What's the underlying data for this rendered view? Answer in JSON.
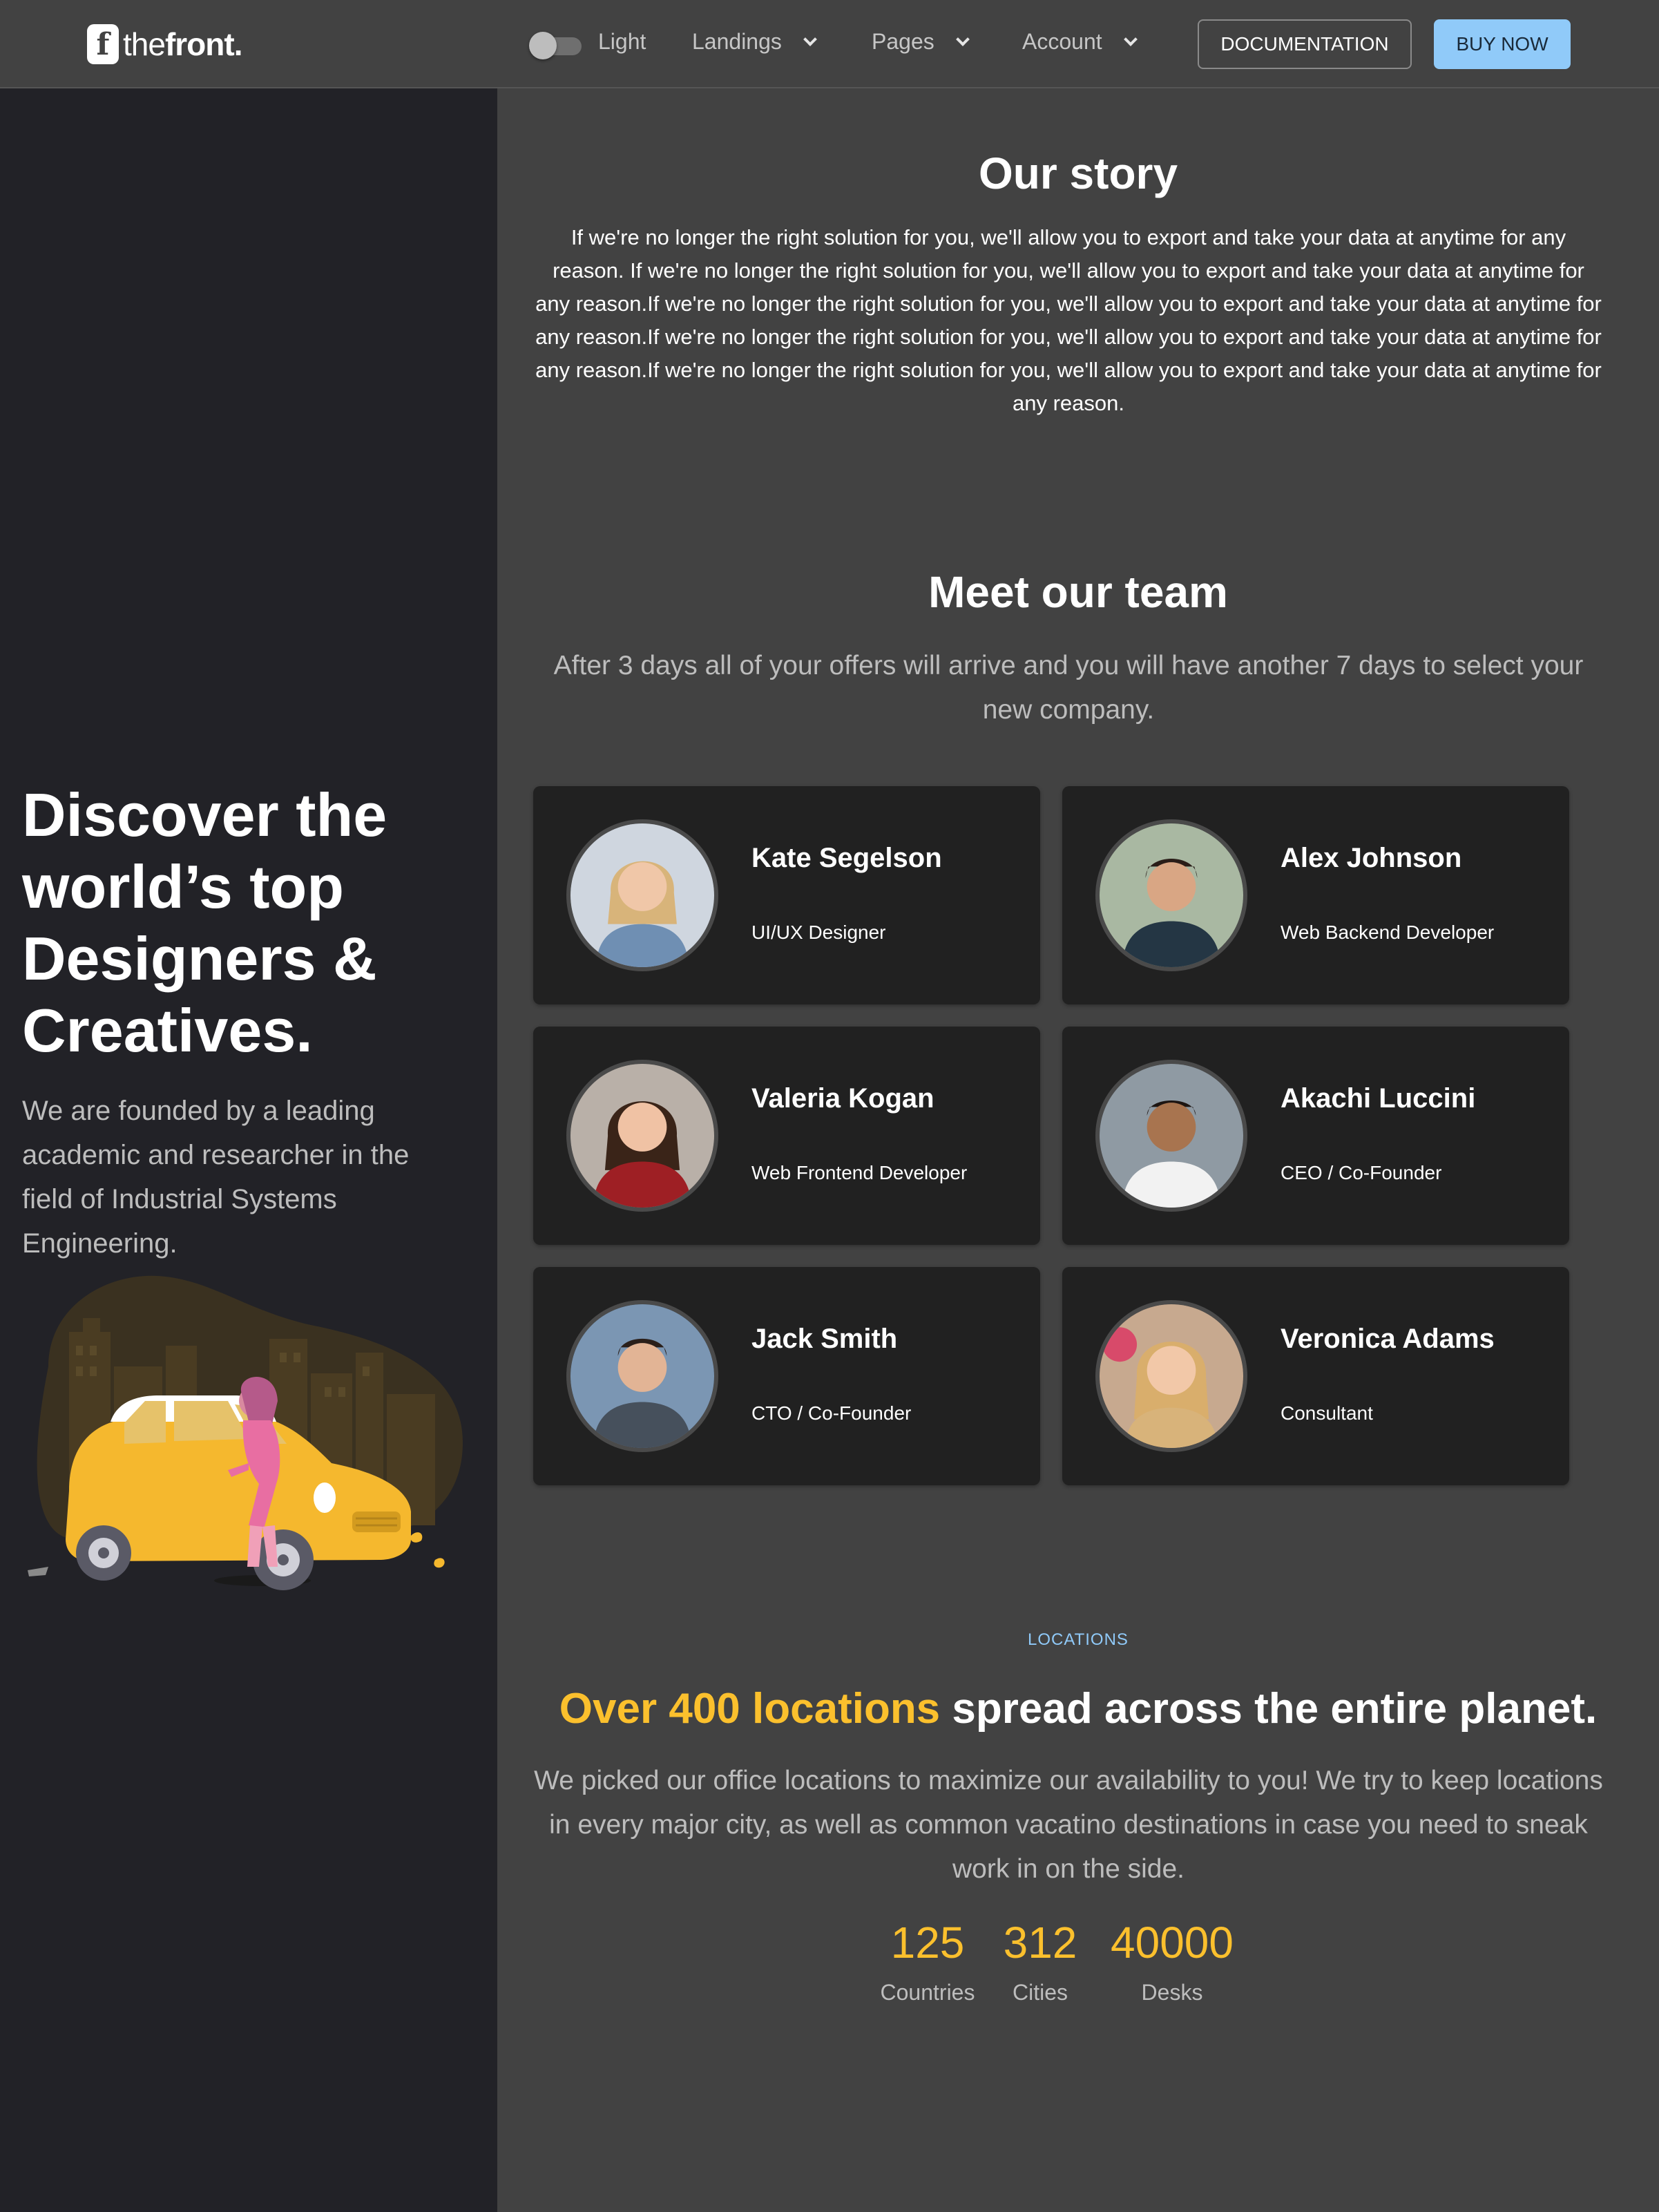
{
  "header": {
    "logo_text_light": "the",
    "logo_text_bold": "front",
    "logo_text_dot": ".",
    "logo_mark": "f",
    "theme_label": "Light",
    "nav": [
      {
        "label": "Landings"
      },
      {
        "label": "Pages"
      },
      {
        "label": "Account"
      }
    ],
    "documentation_label": "DOCUMENTATION",
    "buy_label": "BUY NOW"
  },
  "sidebar": {
    "hero_title": "Discover the world’s top Designers & Creatives.",
    "hero_subtitle": "We are founded by a leading academic and researcher in the field of Industrial Systems Engineering."
  },
  "story": {
    "title": "Our story",
    "text": "If we're no longer the right solution for you, we'll allow you to export and take your data at anytime for any reason. If we're no longer the right solution for you, we'll allow you to export and take your data at anytime for any reason.If we're no longer the right solution for you, we'll allow you to export and take your data at anytime for any reason.If we're no longer the right solution for you, we'll allow you to export and take your data at anytime for any reason.If we're no longer the right solution for you, we'll allow you to export and take your data at anytime for any reason."
  },
  "team": {
    "title": "Meet our team",
    "subtitle": "After 3 days all of your offers will arrive and you will have another 7 days to select your new company.",
    "members": [
      {
        "name": "Kate Segelson",
        "role": "UI/UX Designer"
      },
      {
        "name": "Alex Johnson",
        "role": "Web Backend Developer"
      },
      {
        "name": "Valeria Kogan",
        "role": "Web Frontend Developer"
      },
      {
        "name": "Akachi Luccini",
        "role": "CEO / Co-Founder"
      },
      {
        "name": "Jack Smith",
        "role": "CTO / Co-Founder"
      },
      {
        "name": "Veronica Adams",
        "role": "Consultant"
      }
    ]
  },
  "locations": {
    "kicker": "LOCATIONS",
    "title_accent": "Over 400 locations",
    "title_rest": "spread across the entire planet.",
    "subtitle": "We picked our office locations to maximize our availability to you! We try to keep locations in every major city, as well as common vacatino destinations in case you need to sneak work in on the side.",
    "stats": [
      {
        "value": "125",
        "label": "Countries"
      },
      {
        "value": "312",
        "label": "Cities"
      },
      {
        "value": "40000",
        "label": "Desks"
      }
    ]
  },
  "colors": {
    "accent_yellow": "#fbc02d",
    "accent_blue": "#90caf9",
    "background": "#424242",
    "sidebar": "#222227",
    "card": "#212121"
  }
}
